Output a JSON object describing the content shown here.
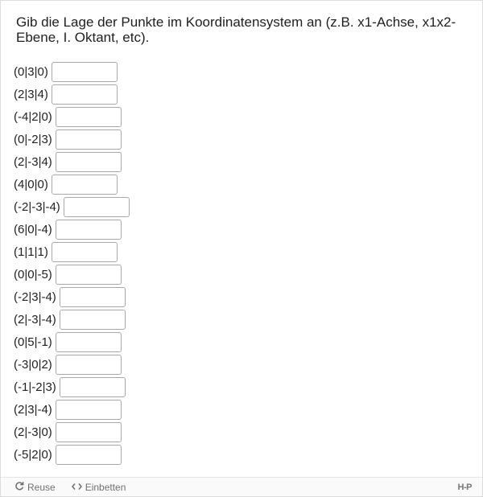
{
  "task": {
    "text": "Gib die Lage der Punkte im Koordinatensystem an (z.B. x1-Achse, x1x2-Ebene, I. Oktant, etc)."
  },
  "points": [
    {
      "label": "(0|3|0)",
      "value": ""
    },
    {
      "label": "(2|3|4)",
      "value": ""
    },
    {
      "label": "(-4|2|0)",
      "value": ""
    },
    {
      "label": "(0|-2|3)",
      "value": ""
    },
    {
      "label": "(2|-3|4)",
      "value": ""
    },
    {
      "label": "(4|0|0)",
      "value": ""
    },
    {
      "label": "(-2|-3|-4)",
      "value": ""
    },
    {
      "label": "(6|0|-4)",
      "value": ""
    },
    {
      "label": "(1|1|1)",
      "value": ""
    },
    {
      "label": "(0|0|-5)",
      "value": ""
    },
    {
      "label": "(-2|3|-4)",
      "value": ""
    },
    {
      "label": "(2|-3|-4)",
      "value": ""
    },
    {
      "label": "(0|5|-1)",
      "value": ""
    },
    {
      "label": "(-3|0|2)",
      "value": ""
    },
    {
      "label": "(-1|-2|3)",
      "value": ""
    },
    {
      "label": "(2|3|-4)",
      "value": ""
    },
    {
      "label": "(2|-3|0)",
      "value": ""
    },
    {
      "label": "(-5|2|0)",
      "value": ""
    }
  ],
  "footer": {
    "reuse_label": "Reuse",
    "reuse_icon": "refresh-icon",
    "embed_label": "Einbetten",
    "embed_icon": "code-icon",
    "brand": "H-P"
  }
}
